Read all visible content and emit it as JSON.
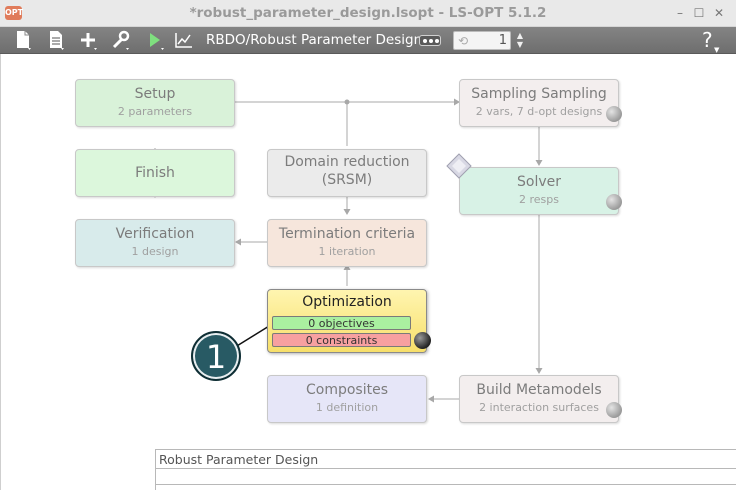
{
  "window": {
    "title": "*robust_parameter_design.lsopt - LS-OPT 5.1.2",
    "app_icon": "OPT",
    "controls": [
      "–",
      "☐",
      "✕"
    ]
  },
  "toolbar": {
    "icons": [
      "new-file-icon",
      "file-list-icon",
      "add-icon",
      "wrench-icon",
      "run-icon",
      "chart-icon"
    ],
    "mode_label": "RBDO/Robust Parameter Design",
    "iteration_value": "1",
    "help_label": "?"
  },
  "flow": {
    "setup": {
      "title": "Setup",
      "sub": "2 parameters"
    },
    "sampling": {
      "title": "Sampling Sampling",
      "sub": "2 vars, 7 d-opt designs"
    },
    "finish": {
      "title": "Finish"
    },
    "domain_reduction": {
      "title_line1": "Domain reduction",
      "title_line2": "(SRSM)"
    },
    "solver": {
      "title": "Solver",
      "sub": "2 resps"
    },
    "verification": {
      "title": "Verification",
      "sub": "1 design"
    },
    "termination": {
      "title": "Termination criteria",
      "sub": "1 iteration"
    },
    "optimization": {
      "title": "Optimization",
      "objectives": "0 objectives",
      "constraints": "0 constraints"
    },
    "composites": {
      "title": "Composites",
      "sub": "1 definition"
    },
    "metamodels": {
      "title": "Build Metamodels",
      "sub": "2 interaction surfaces"
    }
  },
  "callout": {
    "number": "1"
  },
  "panel": {
    "title": "Robust Parameter Design"
  },
  "colors": {
    "setup": "#d9f2d9",
    "finish": "#dcf7dc",
    "domain_reduction": "#ebebeb",
    "sampling": "#f3eeee",
    "solver": "#d8f2e6",
    "verification": "#d8ebeb",
    "termination": "#f6e6dc",
    "composites": "#e6e6f8",
    "metamodels": "#f3eeee",
    "callout": "#285a64"
  }
}
